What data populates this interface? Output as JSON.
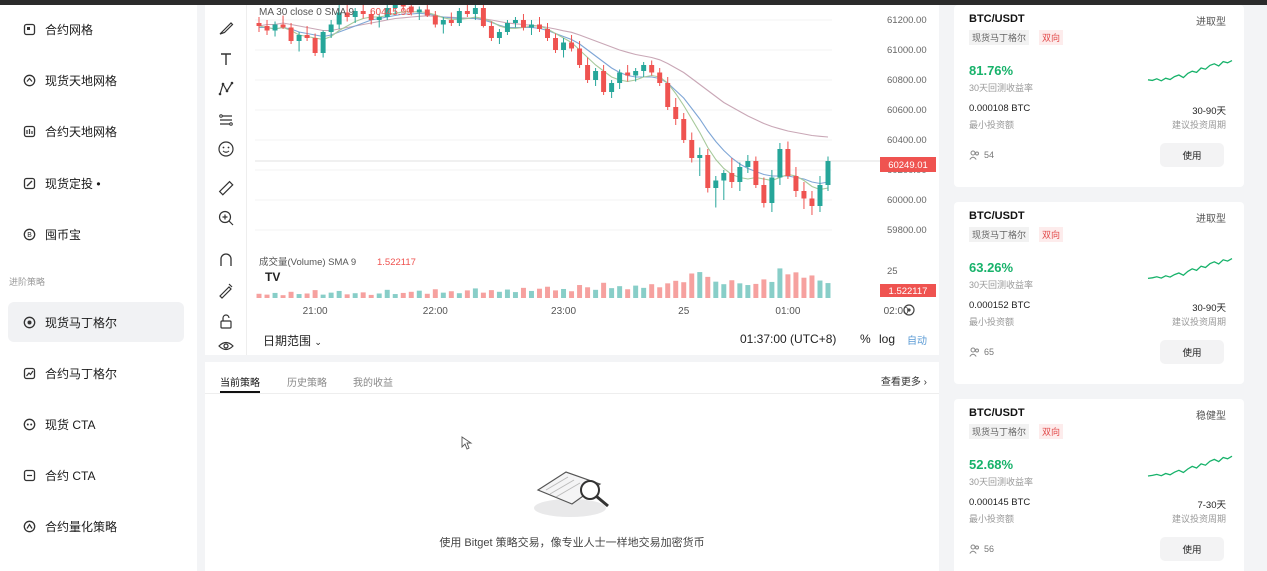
{
  "sidebar": {
    "items": [
      {
        "label": "合约网格",
        "icon": "contract-grid-icon"
      },
      {
        "label": "现货天地网格",
        "icon": "spot-range-grid-icon"
      },
      {
        "label": "合约天地网格",
        "icon": "contract-range-grid-icon"
      },
      {
        "label": "现货定投 •",
        "icon": "spot-dca-icon"
      },
      {
        "label": "囤币宝",
        "icon": "coin-hoard-icon"
      }
    ],
    "section_label": "进阶策略",
    "advanced_items": [
      {
        "label": "现货马丁格尔",
        "icon": "spot-martingale-icon"
      },
      {
        "label": "合约马丁格尔",
        "icon": "contract-martingale-icon"
      },
      {
        "label": "现货 CTA",
        "icon": "spot-cta-icon"
      },
      {
        "label": "合约 CTA",
        "icon": "contract-cta-icon"
      },
      {
        "label": "合约量化策略",
        "icon": "quant-strategy-icon"
      }
    ]
  },
  "chart": {
    "indicator_label": "MA 30 close 0 SMA 9",
    "indicator_value": "60445.99",
    "volume_label": "成交量(Volume) SMA 9",
    "volume_value": "1.522117",
    "current_price": "60249.01",
    "volume_tag": "1.522117",
    "vol_axis_tick": "25",
    "watermark": "TV",
    "price_ticks": [
      "61200.00",
      "61000.00",
      "60800.00",
      "60600.00",
      "60400.00",
      "60200.00",
      "60000.00",
      "59800.00"
    ],
    "time_ticks": [
      "21:00",
      "22:00",
      "23:00",
      "25",
      "01:00",
      "02:00"
    ],
    "date_range_label": "日期范围",
    "clock": "01:37:00 (UTC+8)",
    "pct_label": "%",
    "log_label": "log",
    "auto_label": "自动",
    "colors": {
      "up": "#26a69a",
      "down": "#ef5350",
      "accent": "#5b9bd5"
    }
  },
  "chart_data": {
    "type": "candlestick",
    "ylim": [
      59700,
      61300
    ],
    "candles": [
      [
        61180,
        61220,
        61120,
        61160
      ],
      [
        61160,
        61200,
        61100,
        61130
      ],
      [
        61130,
        61190,
        61090,
        61170
      ],
      [
        61170,
        61230,
        61140,
        61150
      ],
      [
        61150,
        61180,
        61040,
        61060
      ],
      [
        61060,
        61120,
        60990,
        61100
      ],
      [
        61100,
        61160,
        61060,
        61080
      ],
      [
        61080,
        61110,
        60960,
        60980
      ],
      [
        60980,
        61130,
        60950,
        61120
      ],
      [
        61120,
        61200,
        61080,
        61170
      ],
      [
        61170,
        61300,
        61140,
        61250
      ],
      [
        61250,
        61310,
        61190,
        61220
      ],
      [
        61220,
        61280,
        61180,
        61260
      ],
      [
        61260,
        61300,
        61210,
        61240
      ],
      [
        61240,
        61270,
        61170,
        61200
      ],
      [
        61200,
        61240,
        61150,
        61220
      ],
      [
        61220,
        61300,
        61200,
        61280
      ],
      [
        61280,
        61320,
        61240,
        61300
      ],
      [
        61300,
        61320,
        61260,
        61290
      ],
      [
        61290,
        61300,
        61230,
        61250
      ],
      [
        61250,
        61290,
        61200,
        61270
      ],
      [
        61270,
        61300,
        61220,
        61230
      ],
      [
        61230,
        61260,
        61150,
        61170
      ],
      [
        61170,
        61220,
        61110,
        61200
      ],
      [
        61200,
        61250,
        61160,
        61180
      ],
      [
        61180,
        61280,
        61160,
        61260
      ],
      [
        61260,
        61310,
        61220,
        61240
      ],
      [
        61240,
        61300,
        61200,
        61280
      ],
      [
        61280,
        61300,
        61150,
        61160
      ],
      [
        61160,
        61190,
        61060,
        61080
      ],
      [
        61080,
        61140,
        61040,
        61120
      ],
      [
        61120,
        61200,
        61100,
        61180
      ],
      [
        61180,
        61220,
        61150,
        61200
      ],
      [
        61200,
        61240,
        61130,
        61150
      ],
      [
        61150,
        61200,
        61100,
        61170
      ],
      [
        61170,
        61220,
        61120,
        61140
      ],
      [
        61140,
        61180,
        61060,
        61080
      ],
      [
        61080,
        61110,
        60980,
        61000
      ],
      [
        61000,
        61080,
        60950,
        61050
      ],
      [
        61050,
        61100,
        60990,
        61010
      ],
      [
        61010,
        61060,
        60880,
        60900
      ],
      [
        60900,
        60950,
        60780,
        60800
      ],
      [
        60800,
        60880,
        60760,
        60860
      ],
      [
        60860,
        60900,
        60700,
        60720
      ],
      [
        60720,
        60800,
        60680,
        60780
      ],
      [
        60780,
        60870,
        60740,
        60850
      ],
      [
        60850,
        60900,
        60790,
        60830
      ],
      [
        60830,
        60880,
        60790,
        60860
      ],
      [
        60860,
        60920,
        60820,
        60900
      ],
      [
        60900,
        60930,
        60830,
        60850
      ],
      [
        60850,
        60880,
        60760,
        60780
      ],
      [
        60780,
        60820,
        60600,
        60620
      ],
      [
        60620,
        60680,
        60500,
        60540
      ],
      [
        60540,
        60580,
        60380,
        60400
      ],
      [
        60400,
        60450,
        60250,
        60280
      ],
      [
        60280,
        60350,
        60160,
        60300
      ],
      [
        60300,
        60340,
        60050,
        60080
      ],
      [
        60080,
        60160,
        59950,
        60130
      ],
      [
        60130,
        60200,
        60000,
        60180
      ],
      [
        60180,
        60280,
        60080,
        60120
      ],
      [
        60120,
        60250,
        60060,
        60220
      ],
      [
        60220,
        60300,
        60180,
        60260
      ],
      [
        60260,
        60290,
        60080,
        60100
      ],
      [
        60100,
        60150,
        59950,
        59980
      ],
      [
        59980,
        60200,
        59920,
        60150
      ],
      [
        60150,
        60380,
        60100,
        60340
      ],
      [
        60340,
        60390,
        60140,
        60160
      ],
      [
        60160,
        60220,
        60020,
        60060
      ],
      [
        60060,
        60120,
        59940,
        60010
      ],
      [
        60010,
        60060,
        59900,
        59960
      ],
      [
        59960,
        60160,
        59920,
        60100
      ],
      [
        60100,
        60290,
        60060,
        60260
      ]
    ],
    "volumes": [
      1.5,
      1.2,
      1.8,
      1.0,
      2.2,
      1.4,
      1.6,
      2.8,
      1.2,
      1.9,
      2.5,
      1.3,
      1.7,
      2.0,
      1.1,
      1.6,
      2.9,
      1.4,
      1.8,
      2.2,
      2.6,
      1.5,
      3.1,
      1.9,
      2.4,
      1.7,
      2.7,
      3.4,
      1.9,
      2.8,
      2.2,
      3.0,
      2.1,
      3.6,
      2.5,
      3.3,
      4.0,
      2.7,
      3.2,
      2.4,
      4.6,
      3.8,
      2.9,
      5.4,
      3.5,
      4.2,
      3.1,
      4.4,
      3.6,
      4.9,
      3.8,
      5.2,
      6.1,
      5.6,
      8.7,
      9.2,
      7.5,
      5.8,
      4.9,
      6.3,
      5.2,
      4.6,
      5.0,
      6.6,
      5.7,
      10.5,
      8.4,
      9.1,
      7.2,
      8.0,
      6.2,
      5.3
    ],
    "ma_lines": [
      {
        "color": "#c9a7b6",
        "values": [
          61160,
          61170,
          61170,
          61180,
          61170,
          61160,
          61150,
          61140,
          61130,
          61130,
          61140,
          61150,
          61160,
          61170,
          61180,
          61190,
          61200,
          61210,
          61215,
          61220,
          61225,
          61228,
          61225,
          61220,
          61218,
          61215,
          61213,
          61212,
          61208,
          61200,
          61190,
          61180,
          61175,
          61170,
          61165,
          61160,
          61150,
          61140,
          61128,
          61118,
          61100,
          61080,
          61060,
          61040,
          61020,
          61000,
          60985,
          60970,
          60960,
          60950,
          60935,
          60910,
          60880,
          60850,
          60810,
          60770,
          60730,
          60690,
          60650,
          60620,
          60590,
          60560,
          60535,
          60510,
          60490,
          60475,
          60460,
          60450,
          60440,
          60430,
          60425,
          60420
        ]
      },
      {
        "color": "#7fa6d6",
        "values": [
          61150,
          61150,
          61140,
          61150,
          61140,
          61120,
          61110,
          61100,
          61090,
          61100,
          61120,
          61140,
          61160,
          61180,
          61200,
          61210,
          61220,
          61230,
          61240,
          61240,
          61245,
          61240,
          61230,
          61220,
          61215,
          61210,
          61210,
          61210,
          61200,
          61185,
          61165,
          61150,
          61150,
          61150,
          61150,
          61145,
          61130,
          61110,
          61090,
          61070,
          61040,
          61000,
          60960,
          60920,
          60880,
          60850,
          60830,
          60820,
          60820,
          60820,
          60810,
          60780,
          60730,
          60680,
          60610,
          60540,
          60460,
          60390,
          60330,
          60280,
          60240,
          60210,
          60190,
          60170,
          60160,
          60160,
          60160,
          60150,
          60140,
          60120,
          60110,
          60120
        ]
      },
      {
        "color": "#a7c99b",
        "values": [
          61160,
          61150,
          61140,
          61150,
          61130,
          61100,
          61090,
          61080,
          61070,
          61090,
          61130,
          61160,
          61190,
          61210,
          61220,
          61220,
          61230,
          61245,
          61255,
          61255,
          61255,
          61250,
          61235,
          61215,
          61205,
          61205,
          61210,
          61220,
          61210,
          61190,
          61160,
          61145,
          61145,
          61150,
          61160,
          61160,
          61140,
          61110,
          61080,
          61050,
          61000,
          60950,
          60900,
          60860,
          60820,
          60800,
          60790,
          60800,
          60820,
          60830,
          60820,
          60780,
          60710,
          60630,
          60540,
          60450,
          60350,
          60270,
          60210,
          60170,
          60150,
          60140,
          60150,
          60140,
          60130,
          60150,
          60170,
          60160,
          60130,
          60090,
          60070,
          60080
        ]
      }
    ]
  },
  "bottom": {
    "tabs": [
      "当前策略",
      "历史策略",
      "我的收益"
    ],
    "see_more": "查看更多",
    "empty_text": "使用 Bitget 策略交易，像专业人士一样地交易加密货币"
  },
  "cards": [
    {
      "pair": "BTC/USDT",
      "risk": "进取型",
      "tag1": "现货马丁格尔",
      "tag2": "双向",
      "rate": "81.76%",
      "rate_label": "30天回测收益率",
      "min": "0.000108 BTC",
      "min_label": "最小投资额",
      "period": "30-90天",
      "period_label": "建议投资周期",
      "users": "54",
      "use": "使用",
      "spark": [
        0.35,
        0.33,
        0.38,
        0.32,
        0.4,
        0.36,
        0.45,
        0.5,
        0.42,
        0.55,
        0.62,
        0.58,
        0.72,
        0.68,
        0.8,
        0.85,
        0.78,
        0.92,
        0.88,
        0.95
      ]
    },
    {
      "pair": "BTC/USDT",
      "risk": "进取型",
      "tag1": "现货马丁格尔",
      "tag2": "双向",
      "rate": "63.26%",
      "rate_label": "30天回测收益率",
      "min": "0.000152 BTC",
      "min_label": "最小投资额",
      "period": "30-90天",
      "period_label": "建议投资周期",
      "users": "65",
      "use": "使用",
      "spark": [
        0.3,
        0.32,
        0.35,
        0.31,
        0.38,
        0.34,
        0.42,
        0.47,
        0.4,
        0.52,
        0.6,
        0.55,
        0.68,
        0.64,
        0.76,
        0.82,
        0.75,
        0.88,
        0.84,
        0.92
      ]
    },
    {
      "pair": "BTC/USDT",
      "risk": "稳健型",
      "tag1": "现货马丁格尔",
      "tag2": "双向",
      "rate": "52.68%",
      "rate_label": "30天回测收益率",
      "min": "0.000145 BTC",
      "min_label": "最小投资额",
      "period": "7-30天",
      "period_label": "建议投资周期",
      "users": "56",
      "use": "使用",
      "spark": [
        0.28,
        0.3,
        0.33,
        0.29,
        0.36,
        0.32,
        0.4,
        0.46,
        0.39,
        0.5,
        0.58,
        0.53,
        0.66,
        0.62,
        0.74,
        0.8,
        0.73,
        0.86,
        0.82,
        0.9
      ]
    }
  ]
}
